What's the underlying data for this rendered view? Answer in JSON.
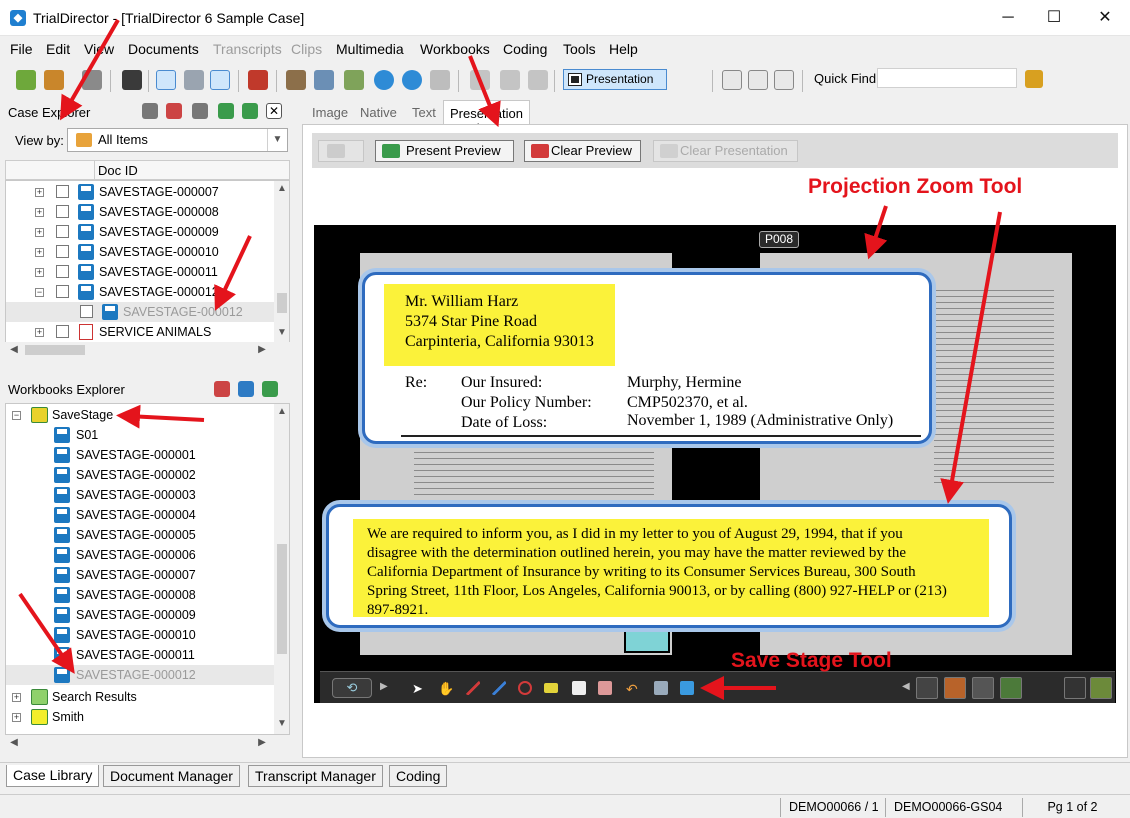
{
  "window": {
    "title": "TrialDirector - [TrialDirector 6 Sample Case]"
  },
  "menu": [
    {
      "label": "File",
      "disabled": false
    },
    {
      "label": "Edit",
      "disabled": false
    },
    {
      "label": "View",
      "disabled": false
    },
    {
      "label": "Documents",
      "disabled": false
    },
    {
      "label": "Transcripts",
      "disabled": true
    },
    {
      "label": "Clips",
      "disabled": true
    },
    {
      "label": "Multimedia",
      "disabled": false
    },
    {
      "label": "Workbooks",
      "disabled": false
    },
    {
      "label": "Coding",
      "disabled": false
    },
    {
      "label": "Tools",
      "disabled": false
    },
    {
      "label": "Help",
      "disabled": false
    }
  ],
  "toolbar": {
    "presentation_label": "Presentation",
    "quick_find_label": "Quick Find",
    "quick_find_value": ""
  },
  "case_explorer": {
    "title": "Case Explorer",
    "view_by_label": "View by:",
    "view_by_value": "All Items",
    "column_header": "Doc ID",
    "items": [
      {
        "label": "SAVESTAGE-000007"
      },
      {
        "label": "SAVESTAGE-000008"
      },
      {
        "label": "SAVESTAGE-000009"
      },
      {
        "label": "SAVESTAGE-000010"
      },
      {
        "label": "SAVESTAGE-000011"
      },
      {
        "label": "SAVESTAGE-000012"
      },
      {
        "label": "SAVESTAGE-000012"
      },
      {
        "label": "SERVICE ANIMALS"
      }
    ]
  },
  "workbooks_explorer": {
    "title": "Workbooks Explorer",
    "items": [
      {
        "label": "SaveStage"
      },
      {
        "label": "S01"
      },
      {
        "label": "SAVESTAGE-000001"
      },
      {
        "label": "SAVESTAGE-000002"
      },
      {
        "label": "SAVESTAGE-000003"
      },
      {
        "label": "SAVESTAGE-000004"
      },
      {
        "label": "SAVESTAGE-000005"
      },
      {
        "label": "SAVESTAGE-000006"
      },
      {
        "label": "SAVESTAGE-000007"
      },
      {
        "label": "SAVESTAGE-000008"
      },
      {
        "label": "SAVESTAGE-000009"
      },
      {
        "label": "SAVESTAGE-000010"
      },
      {
        "label": "SAVESTAGE-000011"
      },
      {
        "label": "SAVESTAGE-000012"
      },
      {
        "label": "Search Results"
      },
      {
        "label": "Smith"
      }
    ]
  },
  "viewer_tabs": [
    {
      "label": "Image"
    },
    {
      "label": "Native"
    },
    {
      "label": "Text"
    },
    {
      "label": "Presentation Preview"
    }
  ],
  "preview_buttons": {
    "present": "Present Preview",
    "clear": "Clear Preview",
    "clear_presentation": "Clear Presentation"
  },
  "document": {
    "page_label": "P008",
    "callout1": {
      "address": [
        "Mr. William Harz",
        "5374 Star Pine Road",
        "Carpinteria, California  93013"
      ],
      "re_label": "Re:",
      "rows": [
        {
          "key": "Our Insured:",
          "value": "Murphy, Hermine"
        },
        {
          "key": "Our Policy Number:",
          "value": "CMP502370, et al."
        },
        {
          "key": "Date of Loss:",
          "value": "November 1, 1989 (Administrative Only)"
        }
      ]
    },
    "callout2": {
      "lines": [
        "We are required to inform you, as I did in my letter to you of August 29, 1994, that if you",
        "disagree with the determination outlined herein, you may have the matter reviewed by the",
        "California Department of Insurance by writing to its Consumer Services Bureau, 300 South",
        "Spring Street, 11th Floor, Los Angeles, California 90013, or by calling (800) 927-HELP or (213)",
        "897-8921."
      ]
    }
  },
  "annotations": {
    "projection_zoom": "Projection Zoom Tool",
    "save_stage": "Save Stage Tool",
    "color": "#e4141c"
  },
  "bottom_tabs": [
    {
      "label": "Case Library"
    },
    {
      "label": "Document Manager"
    },
    {
      "label": "Transcript Manager"
    },
    {
      "label": "Coding"
    }
  ],
  "status": {
    "doc": "DEMO00066 / 1",
    "page_id": "DEMO00066-GS04",
    "page": "Pg 1 of 2"
  }
}
